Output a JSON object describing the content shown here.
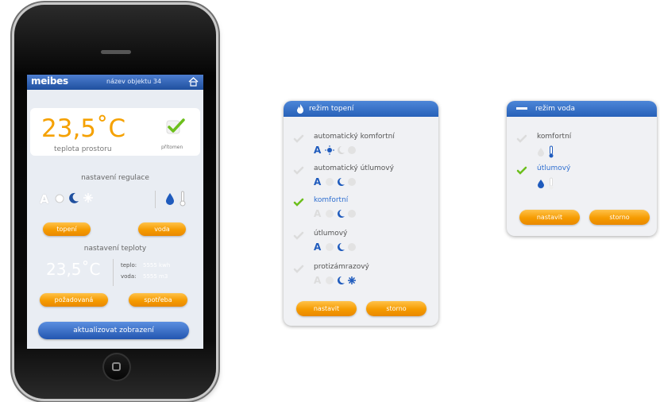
{
  "phone": {
    "logo": "meibes",
    "object_name": "název objektu  34",
    "room_temp": "23,5˚C",
    "room_temp_label": "teplota prostoru",
    "presence_label": "přítomen",
    "regulation_label": "nastavení regulace",
    "btn_heating": "topení",
    "btn_water": "voda",
    "temp_settings_label": "nastavení teploty",
    "set_temp": "23,5˚C",
    "heat_label": "teplo:",
    "heat_value": "5555 kwh",
    "water_label": "voda:",
    "water_value": "5555 m3",
    "btn_required": "požadovaná",
    "btn_consumption": "spotřeba",
    "btn_refresh": "aktualizovat zobrazení"
  },
  "heating_panel": {
    "title": "režim topení",
    "options": [
      {
        "label": "automatický komfortní",
        "selected": false
      },
      {
        "label": "automatický útlumový",
        "selected": false
      },
      {
        "label": "komfortní",
        "selected": true
      },
      {
        "label": "útlumový",
        "selected": false
      },
      {
        "label": "protizámrazový",
        "selected": false
      }
    ],
    "btn_set": "nastavit",
    "btn_cancel": "storno"
  },
  "water_panel": {
    "title": "režim voda",
    "options": [
      {
        "label": "komfortní",
        "selected": false
      },
      {
        "label": "útlumový",
        "selected": true
      }
    ],
    "btn_set": "nastavit",
    "btn_cancel": "storno"
  },
  "colors": {
    "accent_blue": "#2761b8",
    "accent_orange": "#f59b00",
    "check_green": "#6cbf1c"
  }
}
